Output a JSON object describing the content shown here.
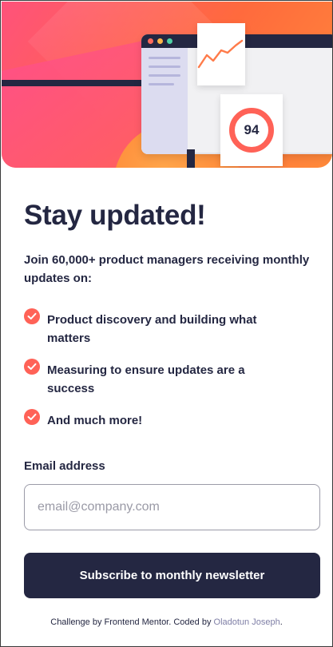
{
  "hero": {
    "score_value": "94",
    "colors": {
      "accent": "#ff6257",
      "dark_navy": "#242742",
      "gradient_start": "#ff527b",
      "gradient_end": "#ff8a3a"
    }
  },
  "signup": {
    "title": "Stay updated!",
    "intro": "Join 60,000+ product managers receiving monthly updates on:",
    "features": [
      "Product discovery and building what matters",
      "Measuring to ensure updates are a success",
      "And much more!"
    ],
    "check_icon": "check-circle-icon",
    "email_label": "Email address",
    "email_placeholder": "email@company.com",
    "email_value": "",
    "submit_label": "Subscribe to monthly newsletter"
  },
  "attribution": {
    "prefix": "Challenge by ",
    "challenge_link": "Frontend Mentor",
    "middle": ". Coded by ",
    "author_link": "Oladotun Joseph",
    "suffix": "."
  }
}
